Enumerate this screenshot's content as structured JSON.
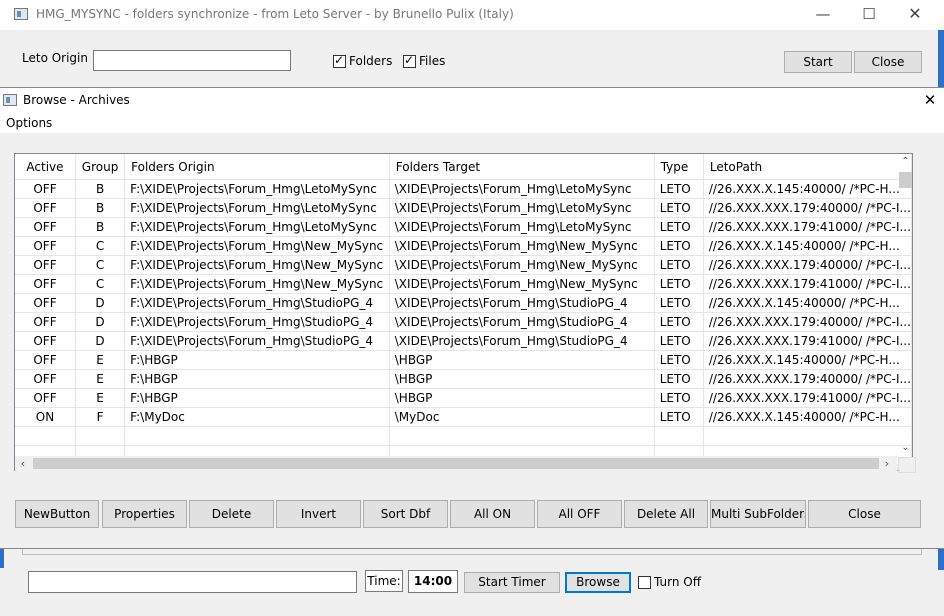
{
  "main_window": {
    "title": "HMG_MYSYNC - folders synchronize - from Leto Server - by Brunello Pulix (Italy)",
    "origin_label": "Leto Origin",
    "origin_value": "",
    "folders_label": "Folders",
    "folders_checked": true,
    "files_label": "Files",
    "files_checked": true,
    "start_button": "Start",
    "close_button": "Close",
    "time_label": "Time:",
    "time_value": "14:00",
    "start_timer_button": "Start Timer",
    "browse_button": "Browse",
    "turn_off_label": "Turn Off",
    "turn_off_checked": false
  },
  "dialog": {
    "title": "Browse - Archives",
    "menu": [
      "Options"
    ],
    "columns": [
      "Active",
      "Group",
      "Folders Origin",
      "Folders Target",
      "Type",
      "LetoPath"
    ],
    "rows": [
      [
        "OFF",
        "B",
        "F:\\XIDE\\Projects\\Forum_Hmg\\LetoMySync",
        "\\XIDE\\Projects\\Forum_Hmg\\LetoMySync",
        "LETO",
        "//26.XXX.X.145:40000/   /*PC-H..."
      ],
      [
        "OFF",
        "B",
        "F:\\XIDE\\Projects\\Forum_Hmg\\LetoMySync",
        "\\XIDE\\Projects\\Forum_Hmg\\LetoMySync",
        "LETO",
        "//26.XXX.XXX.179:40000/  /*PC-I..."
      ],
      [
        "OFF",
        "B",
        "F:\\XIDE\\Projects\\Forum_Hmg\\LetoMySync",
        "\\XIDE\\Projects\\Forum_Hmg\\LetoMySync",
        "LETO",
        "//26.XXX.XXX.179:41000/  /*PC-I..."
      ],
      [
        "OFF",
        "C",
        "F:\\XIDE\\Projects\\Forum_Hmg\\New_MySync",
        "\\XIDE\\Projects\\Forum_Hmg\\New_MySync",
        "LETO",
        "//26.XXX.X.145:40000/   /*PC-H..."
      ],
      [
        "OFF",
        "C",
        "F:\\XIDE\\Projects\\Forum_Hmg\\New_MySync",
        "\\XIDE\\Projects\\Forum_Hmg\\New_MySync",
        "LETO",
        "//26.XXX.XXX.179:40000/  /*PC-I..."
      ],
      [
        "OFF",
        "C",
        "F:\\XIDE\\Projects\\Forum_Hmg\\New_MySync",
        "\\XIDE\\Projects\\Forum_Hmg\\New_MySync",
        "LETO",
        "//26.XXX.XXX.179:41000/  /*PC-I..."
      ],
      [
        "OFF",
        "D",
        "F:\\XIDE\\Projects\\Forum_Hmg\\StudioPG_4",
        "\\XIDE\\Projects\\Forum_Hmg\\StudioPG_4",
        "LETO",
        "//26.XXX.X.145:40000/   /*PC-H..."
      ],
      [
        "OFF",
        "D",
        "F:\\XIDE\\Projects\\Forum_Hmg\\StudioPG_4",
        "\\XIDE\\Projects\\Forum_Hmg\\StudioPG_4",
        "LETO",
        "//26.XXX.XXX.179:40000/  /*PC-I..."
      ],
      [
        "OFF",
        "D",
        "F:\\XIDE\\Projects\\Forum_Hmg\\StudioPG_4",
        "\\XIDE\\Projects\\Forum_Hmg\\StudioPG_4",
        "LETO",
        "//26.XXX.XXX.179:41000/  /*PC-I..."
      ],
      [
        "OFF",
        "E",
        "F:\\HBGP",
        "\\HBGP",
        "LETO",
        "//26.XXX.X.145:40000/   /*PC-H..."
      ],
      [
        "OFF",
        "E",
        "F:\\HBGP",
        "\\HBGP",
        "LETO",
        "//26.XXX.XXX.179:40000/  /*PC-I..."
      ],
      [
        "OFF",
        "E",
        "F:\\HBGP",
        "\\HBGP",
        "LETO",
        "//26.XXX.XXX.179:41000/  /*PC-I..."
      ],
      [
        "ON",
        "F",
        "F:\\MyDoc",
        "\\MyDoc",
        "LETO",
        "//26.XXX.X.145:40000/   /*PC-H..."
      ]
    ],
    "buttons": [
      "NewButton",
      "Properties",
      "Delete",
      "Invert",
      "Sort Dbf",
      "All ON",
      "All OFF",
      "Delete All",
      "Multi SubFolders",
      "Close"
    ]
  }
}
